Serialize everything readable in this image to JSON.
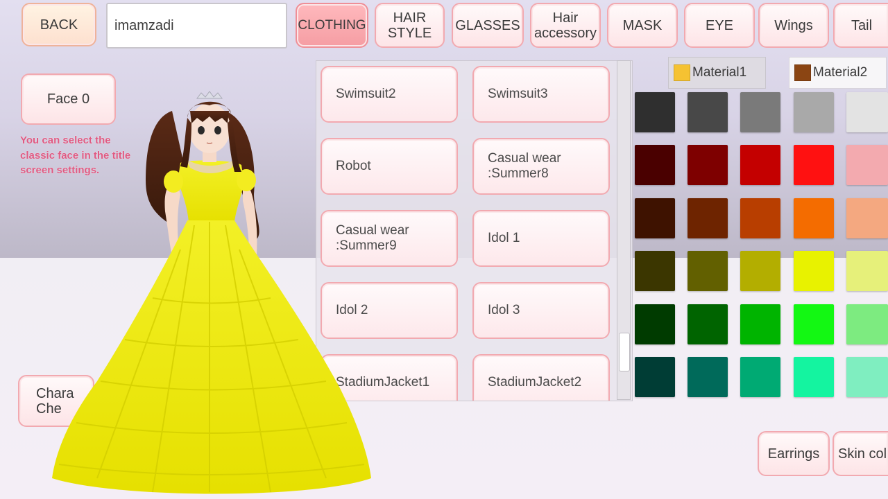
{
  "top_bar": {
    "back_label": "BACK",
    "name_value": "imamzadi",
    "tabs": [
      {
        "label": "CLOTHING"
      },
      {
        "label": "HAIR\nSTYLE"
      },
      {
        "label": "GLASSES"
      },
      {
        "label": "Hair\naccessory"
      },
      {
        "label": "MASK"
      },
      {
        "label": "EYE"
      },
      {
        "label": "Wings"
      },
      {
        "label": "Tail"
      }
    ]
  },
  "left": {
    "face_button": "Face 0",
    "hint": "You can select the classic face in the title screen settings.",
    "character_button": "Chara\nChe"
  },
  "clothing_items": [
    {
      "label": "Swimsuit2"
    },
    {
      "label": "Swimsuit3"
    },
    {
      "label": "Robot"
    },
    {
      "label": "Casual wear\n:Summer8"
    },
    {
      "label": "Casual wear\n:Summer9"
    },
    {
      "label": "Idol 1"
    },
    {
      "label": "Idol 2"
    },
    {
      "label": "Idol 3"
    },
    {
      "label": "StadiumJacket1"
    },
    {
      "label": "StadiumJacket2"
    }
  ],
  "materials": {
    "tabs": [
      {
        "label": "Material1",
        "color": "#f5c232"
      },
      {
        "label": "Material2",
        "color": "#8b4513"
      }
    ],
    "palette": [
      [
        "#2f2f2f",
        "#484848",
        "#7a7a7a",
        "#a9a9a9",
        "#e3e3e3"
      ],
      [
        "#4a0000",
        "#7e0000",
        "#c40000",
        "#ff1111",
        "#f3aaaf"
      ],
      [
        "#3e1200",
        "#6e2400",
        "#b83e00",
        "#f46c00",
        "#f4a880"
      ],
      [
        "#3b3600",
        "#626000",
        "#b3ae00",
        "#e8f200",
        "#e6f07a"
      ],
      [
        "#003b00",
        "#006400",
        "#00b400",
        "#13f813",
        "#7deb80"
      ],
      [
        "#003d35",
        "#006a5a",
        "#00aa73",
        "#14f4a0",
        "#7feec0"
      ]
    ]
  },
  "bottom_right": {
    "earrings": "Earrings",
    "skin_color": "Skin col"
  }
}
